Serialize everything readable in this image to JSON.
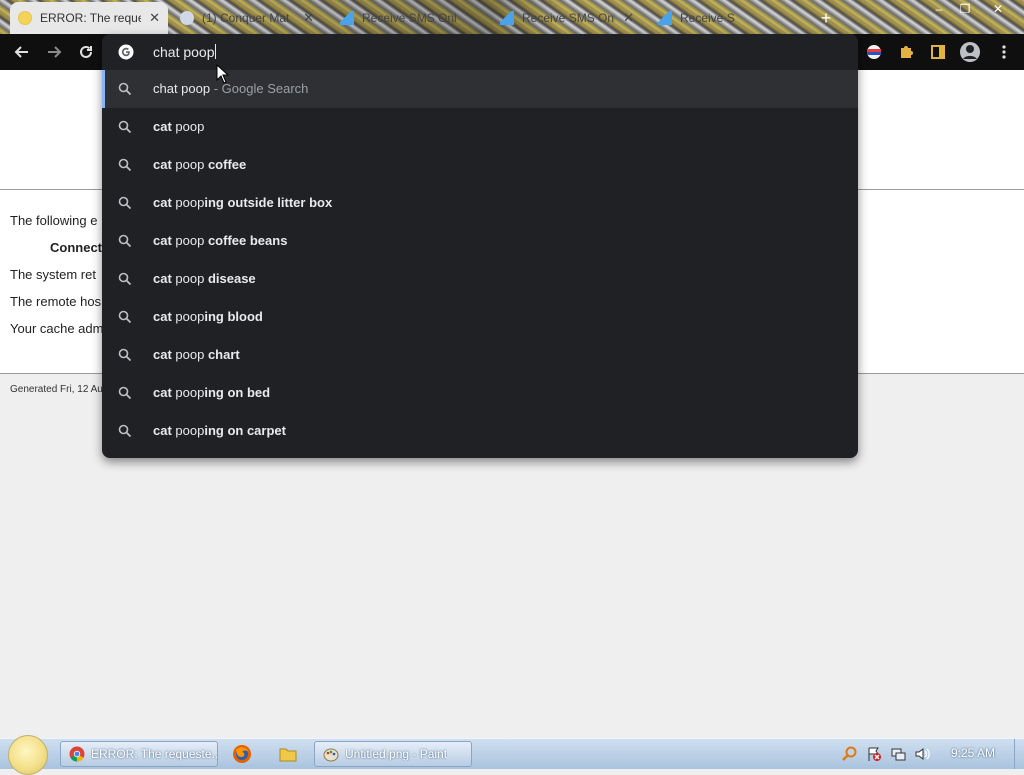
{
  "browser": {
    "tabs": [
      {
        "label": "ERROR: The reque",
        "active": true,
        "favicon": "face-icon"
      },
      {
        "label": "(1) Conquer Mat",
        "active": false,
        "favicon": "globe-icon"
      },
      {
        "label": "Receive SMS Onl",
        "active": false,
        "favicon": "triangle-icon"
      },
      {
        "label": "Receive SMS Onl",
        "active": false,
        "favicon": "triangle-icon"
      },
      {
        "label": "Receive S",
        "active": false,
        "favicon": "triangle-icon"
      }
    ],
    "new_tab_glyph": "+",
    "window_controls": {
      "minimize": "–",
      "restore": "❐",
      "close": "✕"
    }
  },
  "omnibox": {
    "query": "chat poop",
    "suggestions": [
      {
        "match": "chat poop",
        "rest": "",
        "hint": " - Google Search",
        "selected": true
      },
      {
        "match": "cat",
        "rest": " poop",
        "tail": "",
        "selected": false
      },
      {
        "match": "cat",
        "rest": " poop",
        "tail": " coffee",
        "selected": false
      },
      {
        "match": "cat",
        "rest": " poop",
        "tail": "ing outside litter box",
        "selected": false
      },
      {
        "match": "cat",
        "rest": " poop",
        "tail": " coffee beans",
        "selected": false
      },
      {
        "match": "cat",
        "rest": " poop",
        "tail": " disease",
        "selected": false
      },
      {
        "match": "cat",
        "rest": " poop",
        "tail": "ing blood",
        "selected": false
      },
      {
        "match": "cat",
        "rest": " poop",
        "tail": " chart",
        "selected": false
      },
      {
        "match": "cat",
        "rest": " poop",
        "tail": "ing on bed",
        "selected": false
      },
      {
        "match": "cat",
        "rest": " poop",
        "tail": "ing on carpet",
        "selected": false
      }
    ]
  },
  "page": {
    "line1": "The following e",
    "line2": "Connect",
    "line3": "The system ret",
    "line4": "The remote hos",
    "line5": "Your cache adm",
    "footer": "Generated Fri, 12 Au"
  },
  "taskbar": {
    "buttons": [
      {
        "label": "ERROR: The requeste...",
        "icon": "chrome-icon"
      },
      {
        "label": "Untitled.png - Paint",
        "icon": "paint-icon"
      }
    ],
    "clock": "9:25 AM"
  },
  "colors": {
    "omnibox_bg": "#202124",
    "selected_row": "#2f3033",
    "accent": "#8ab4f8",
    "toolbar": "#0f0f0f"
  }
}
